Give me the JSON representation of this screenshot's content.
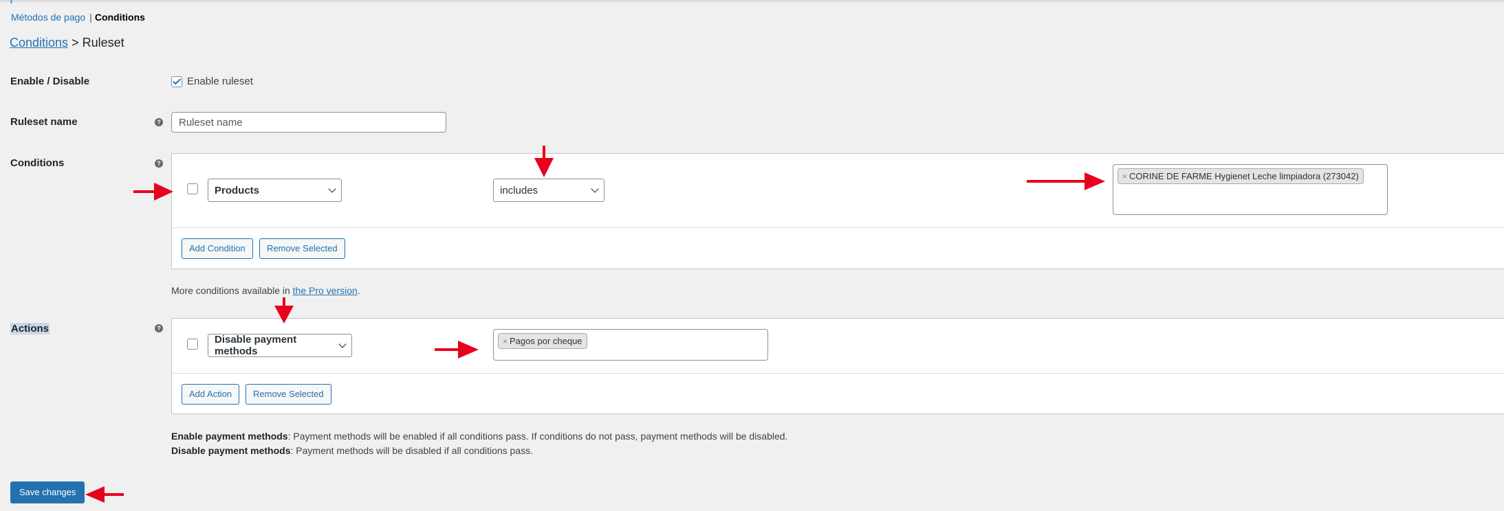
{
  "nav": {
    "link": "Métodos de pago",
    "separator": "|",
    "current": "Conditions"
  },
  "title": {
    "link": "Conditions",
    "rest": "> Ruleset"
  },
  "enable": {
    "label": "Enable / Disable",
    "checkbox_label": "Enable ruleset",
    "checked": true
  },
  "ruleset_name": {
    "label": "Ruleset name",
    "placeholder": "Ruleset name",
    "help": "?"
  },
  "conditions": {
    "label": "Conditions",
    "help": "?",
    "row": {
      "type": "Products",
      "operator": "includes",
      "values": [
        "CORINE DE FARME Hygienet Leche limpiadora (273042)"
      ]
    },
    "add_button": "Add Condition",
    "remove_button": "Remove Selected",
    "more_prefix": "More conditions available in ",
    "more_link": "the Pro version",
    "more_suffix": "."
  },
  "actions": {
    "label": "Actions",
    "help": "?",
    "row": {
      "type": "Disable payment methods",
      "values": [
        "Pagos por cheque"
      ]
    },
    "add_button": "Add Action",
    "remove_button": "Remove Selected"
  },
  "notes": {
    "enable_bold": "Enable payment methods",
    "enable_text": ": Payment methods will be enabled if all conditions pass. If conditions do not pass, payment methods will be disabled.",
    "disable_bold": "Disable payment methods",
    "disable_text": ": Payment methods will be disabled if all conditions pass."
  },
  "save_button": "Save changes",
  "tag_remove_symbol": "×",
  "colors": {
    "primary": "#2271b1",
    "arrow": "#e8001c",
    "background": "#f0f0f1"
  }
}
